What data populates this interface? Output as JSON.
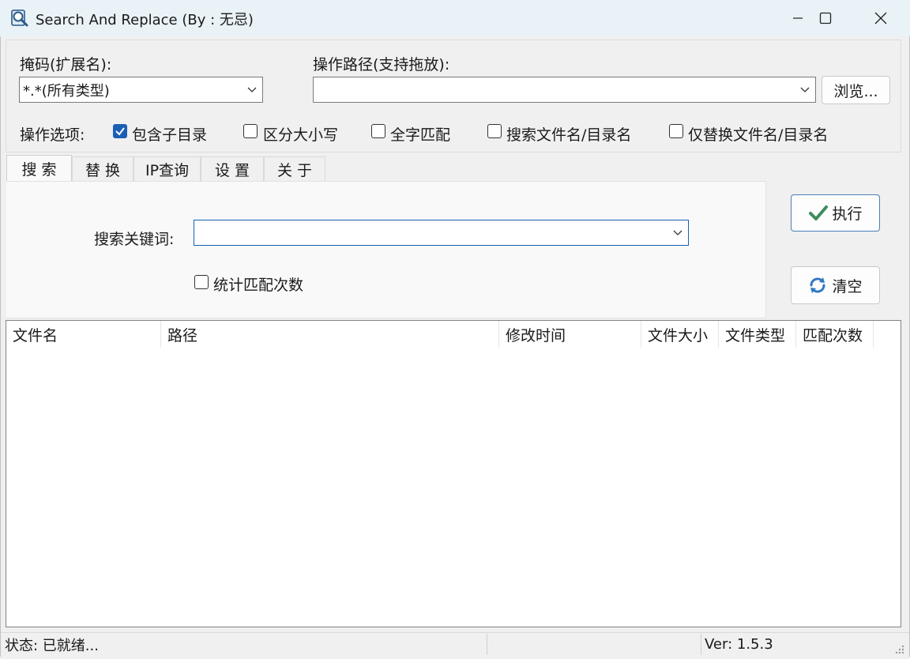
{
  "window": {
    "title": "Search And Replace  (By : 无忌)",
    "icon": "magnifier-document-icon"
  },
  "mask": {
    "label": "掩码(扩展名):",
    "value": "*.*(所有类型)"
  },
  "path": {
    "label": "操作路径(支持拖放):",
    "value": "",
    "browse_label": "浏览..."
  },
  "options": {
    "label": "操作选项:",
    "items": [
      {
        "label": "包含子目录",
        "checked": true
      },
      {
        "label": "区分大小写",
        "checked": false
      },
      {
        "label": "全字匹配",
        "checked": false
      },
      {
        "label": "搜索文件名/目录名",
        "checked": false
      },
      {
        "label": "仅替换文件名/目录名",
        "checked": false
      }
    ]
  },
  "tabs": [
    {
      "label": "搜 索",
      "active": true
    },
    {
      "label": "替 换",
      "active": false
    },
    {
      "label": "IP查询",
      "active": false
    },
    {
      "label": "设 置",
      "active": false
    },
    {
      "label": "关 于",
      "active": false
    }
  ],
  "search": {
    "keyword_label": "搜索关键词:",
    "keyword_value": "",
    "count_matches_label": "统计匹配次数",
    "count_matches_checked": false
  },
  "actions": {
    "execute_label": "执行",
    "clear_label": "清空"
  },
  "table": {
    "columns": [
      "文件名",
      "路径",
      "修改时间",
      "文件大小",
      "文件类型",
      "匹配次数"
    ],
    "rows": []
  },
  "status": {
    "text": "状态: 已就绪...",
    "version": "Ver:  1.5.3"
  },
  "colors": {
    "accent": "#1a5fb4",
    "check_green": "#3c8c5c",
    "refresh_blue": "#2f78c4",
    "titlebar_bg": "#e9f2f6"
  }
}
